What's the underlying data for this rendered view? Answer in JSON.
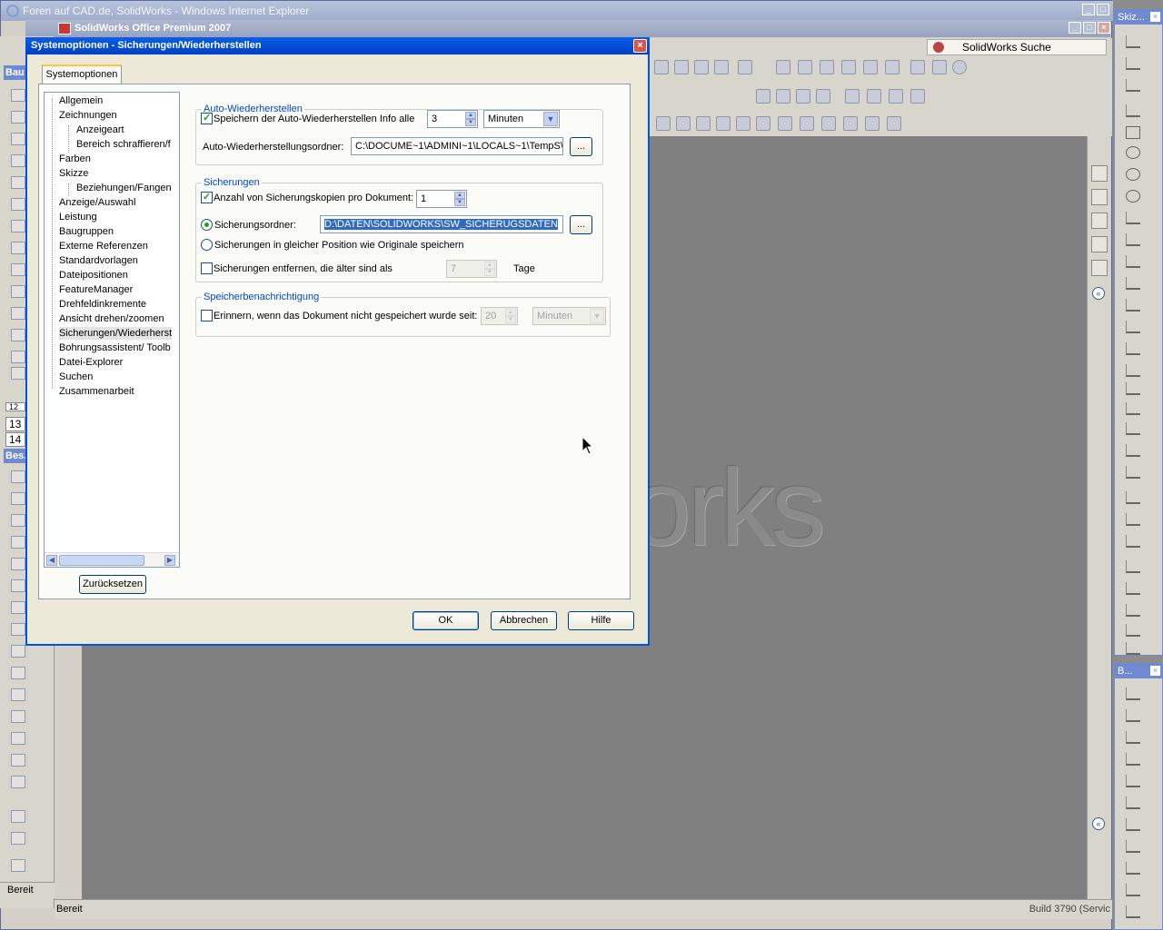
{
  "ie": {
    "title": "Foren auf CAD.de, SolidWorks - Windows Internet Explorer"
  },
  "solidworks": {
    "title": "SolidWorks Office Premium 2007",
    "search_label": "SolidWorks Suche",
    "status": "Bereit",
    "left_status": "Bereit",
    "build_text": "Build 3790 (Servic",
    "watermark": "SolidWorks",
    "left_headers": [
      "Bau",
      "Bes."
    ],
    "left_numbers": [
      "12",
      "13",
      "14"
    ]
  },
  "right_palettes": [
    {
      "title": "Skiz..."
    },
    {
      "title": "B..."
    }
  ],
  "dialog": {
    "title": "Systemoptionen - Sicherungen/Wiederherstellen",
    "tab": "Systemoptionen",
    "tree": [
      {
        "label": "Allgemein",
        "level": 0
      },
      {
        "label": "Zeichnungen",
        "level": 0
      },
      {
        "label": "Anzeigeart",
        "level": 1
      },
      {
        "label": "Bereich schraffieren/f",
        "level": 1
      },
      {
        "label": "Farben",
        "level": 0
      },
      {
        "label": "Skizze",
        "level": 0
      },
      {
        "label": "Beziehungen/Fangen",
        "level": 1
      },
      {
        "label": "Anzeige/Auswahl",
        "level": 0
      },
      {
        "label": "Leistung",
        "level": 0
      },
      {
        "label": "Baugruppen",
        "level": 0
      },
      {
        "label": "Externe Referenzen",
        "level": 0
      },
      {
        "label": "Standardvorlagen",
        "level": 0
      },
      {
        "label": "Dateipositionen",
        "level": 0
      },
      {
        "label": "FeatureManager",
        "level": 0
      },
      {
        "label": "Drehfeldinkremente",
        "level": 0
      },
      {
        "label": "Ansicht drehen/zoomen",
        "level": 0
      },
      {
        "label": "Sicherungen/Wiederherst",
        "level": 0,
        "selected": true
      },
      {
        "label": "Bohrungsassistent/ Toolb",
        "level": 0
      },
      {
        "label": "Datei-Explorer",
        "level": 0
      },
      {
        "label": "Suchen",
        "level": 0
      },
      {
        "label": "Zusammenarbeit",
        "level": 0
      }
    ],
    "reset_button": "Zurücksetzen",
    "autorecover": {
      "group_label": "Auto-Wiederherstellen",
      "save_label": "Speichern der Auto-Wiederherstellen Info alle",
      "save_checked": true,
      "interval": "3",
      "unit": "Minuten",
      "folder_label": "Auto-Wiederherstellungsordner:",
      "folder_value": "C:\\DOCUME~1\\ADMINI~1\\LOCALS~1\\TempS\\",
      "browse": "..."
    },
    "backups": {
      "group_label": "Sicherungen",
      "copies_label": "Anzahl von Sicherungskopien pro Dokument:",
      "copies_checked": true,
      "copies_value": "1",
      "folder_label": "Sicherungsordner:",
      "folder_selected": true,
      "folder_value": "D:\\DATEN\\SOLIDWORKS\\SW_SICHERUGSDATEN",
      "browse": "...",
      "same_location_label": "Sicherungen in gleicher Position wie Originale speichern",
      "remove_label": "Sicherungen entfernen, die älter sind als",
      "remove_checked": false,
      "remove_days": "7",
      "days_unit": "Tage"
    },
    "save_notification": {
      "group_label": "Speicherbenachrichtigung",
      "remind_label": "Erinnern, wenn das Dokument nicht gespeichert wurde seit:",
      "remind_checked": false,
      "remind_value": "20",
      "remind_unit": "Minuten"
    },
    "buttons": {
      "ok": "OK",
      "cancel": "Abbrechen",
      "help": "Hilfe"
    }
  }
}
